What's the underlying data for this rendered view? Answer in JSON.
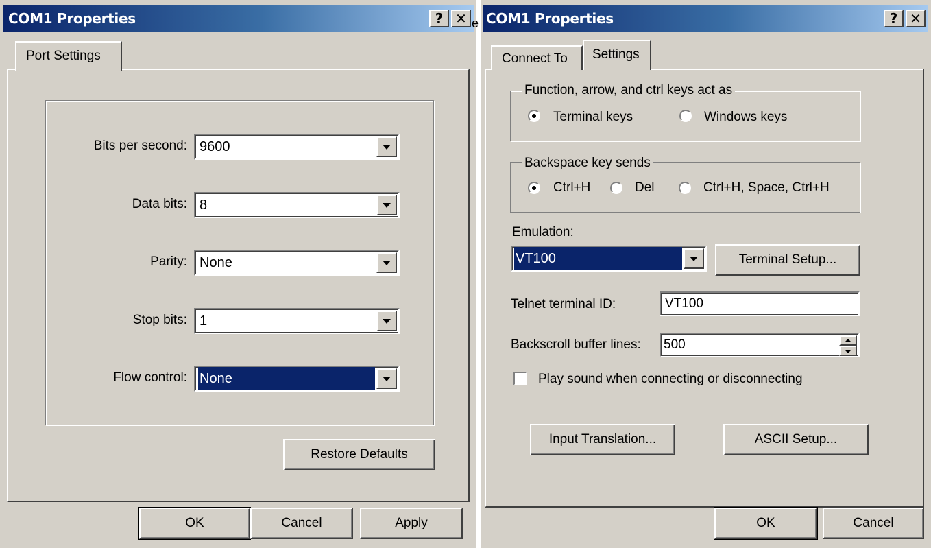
{
  "stray_char": "e",
  "left_dialog": {
    "title": "COM1 Properties",
    "help_glyph": "?",
    "close_glyph": "✕",
    "tabs": [
      "Port Settings"
    ],
    "fields": [
      {
        "label": "Bits per second:",
        "value": "9600"
      },
      {
        "label": "Data bits:",
        "value": "8"
      },
      {
        "label": "Parity:",
        "value": "None"
      },
      {
        "label": "Stop bits:",
        "value": "1"
      },
      {
        "label": "Flow control:",
        "value": "None"
      }
    ],
    "restore_label": "Restore Defaults",
    "ok_label": "OK",
    "cancel_label": "Cancel",
    "apply_label": "Apply"
  },
  "right_dialog": {
    "title": "COM1 Properties",
    "help_glyph": "?",
    "close_glyph": "✕",
    "tabs": [
      "Connect To",
      "Settings"
    ],
    "function_group": {
      "legend": "Function, arrow, and ctrl keys act as",
      "options": [
        "Terminal keys",
        "Windows keys"
      ],
      "selected": "Terminal keys"
    },
    "backspace_group": {
      "legend": "Backspace key sends",
      "options": [
        "Ctrl+H",
        "Del",
        "Ctrl+H, Space, Ctrl+H"
      ],
      "selected": "Ctrl+H"
    },
    "emulation_label": "Emulation:",
    "emulation_value": "VT100",
    "terminal_setup_label": "Terminal Setup...",
    "telnet_label": "Telnet terminal ID:",
    "telnet_value": "VT100",
    "backscroll_label": "Backscroll buffer lines:",
    "backscroll_value": "500",
    "play_sound_label": "Play sound when connecting or disconnecting",
    "play_sound_checked": false,
    "input_translation_label": "Input Translation...",
    "ascii_setup_label": "ASCII Setup...",
    "ok_label": "OK",
    "cancel_label": "Cancel"
  }
}
